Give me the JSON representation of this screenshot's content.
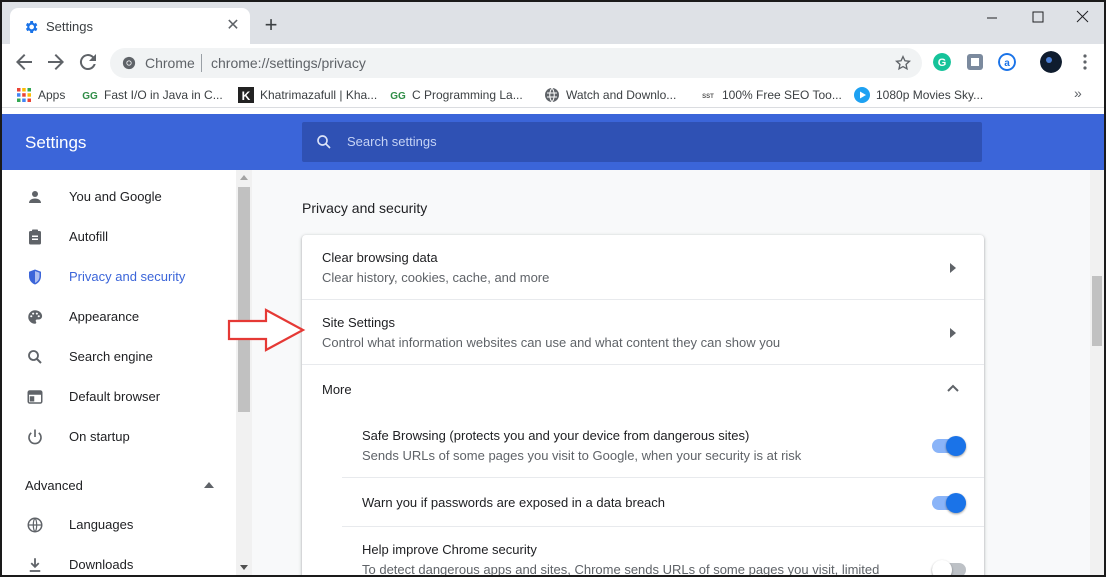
{
  "browser": {
    "tab_title": "Settings",
    "omnibox_site": "Chrome",
    "omnibox_url": "chrome://settings/privacy",
    "accent": "#3b65d9"
  },
  "bookmarks": [
    {
      "label": "Apps",
      "icon": "apps-grid-icon"
    },
    {
      "label": "Fast I/O in Java in C...",
      "icon": "gfg-icon"
    },
    {
      "label": "Khatrimazafull | Kha...",
      "icon": "k-icon"
    },
    {
      "label": "C Programming La...",
      "icon": "gfg-icon"
    },
    {
      "label": "Watch and Downlo...",
      "icon": "globe-icon"
    },
    {
      "label": "100% Free SEO Too...",
      "icon": "sst-icon"
    },
    {
      "label": "1080p Movies Sky...",
      "icon": "play-icon"
    }
  ],
  "settings": {
    "title": "Settings",
    "search_placeholder": "Search settings"
  },
  "sidebar": {
    "items": [
      {
        "label": "You and Google",
        "icon": "person-icon"
      },
      {
        "label": "Autofill",
        "icon": "clipboard-icon"
      },
      {
        "label": "Privacy and security",
        "icon": "shield-icon",
        "active": true
      },
      {
        "label": "Appearance",
        "icon": "palette-icon"
      },
      {
        "label": "Search engine",
        "icon": "search-icon"
      },
      {
        "label": "Default browser",
        "icon": "browser-window-icon"
      },
      {
        "label": "On startup",
        "icon": "power-icon"
      }
    ],
    "advanced_label": "Advanced",
    "advanced_items": [
      {
        "label": "Languages",
        "icon": "globe-icon"
      },
      {
        "label": "Downloads",
        "icon": "download-icon"
      }
    ]
  },
  "main": {
    "section_title": "Privacy and security",
    "rows": [
      {
        "title": "Clear browsing data",
        "subtitle": "Clear history, cookies, cache, and more"
      },
      {
        "title": "Site Settings",
        "subtitle": "Control what information websites can use and what content they can show you"
      }
    ],
    "more_label": "More",
    "subrows": [
      {
        "title": "Safe Browsing (protects you and your device from dangerous sites)",
        "subtitle": "Sends URLs of some pages you visit to Google, when your security is at risk",
        "toggle": true
      },
      {
        "title": "Warn you if passwords are exposed in a data breach",
        "subtitle": "",
        "toggle": true
      },
      {
        "title": "Help improve Chrome security",
        "subtitle": "To detect dangerous apps and sites, Chrome sends URLs of some pages you visit, limited",
        "toggle": false
      }
    ]
  }
}
